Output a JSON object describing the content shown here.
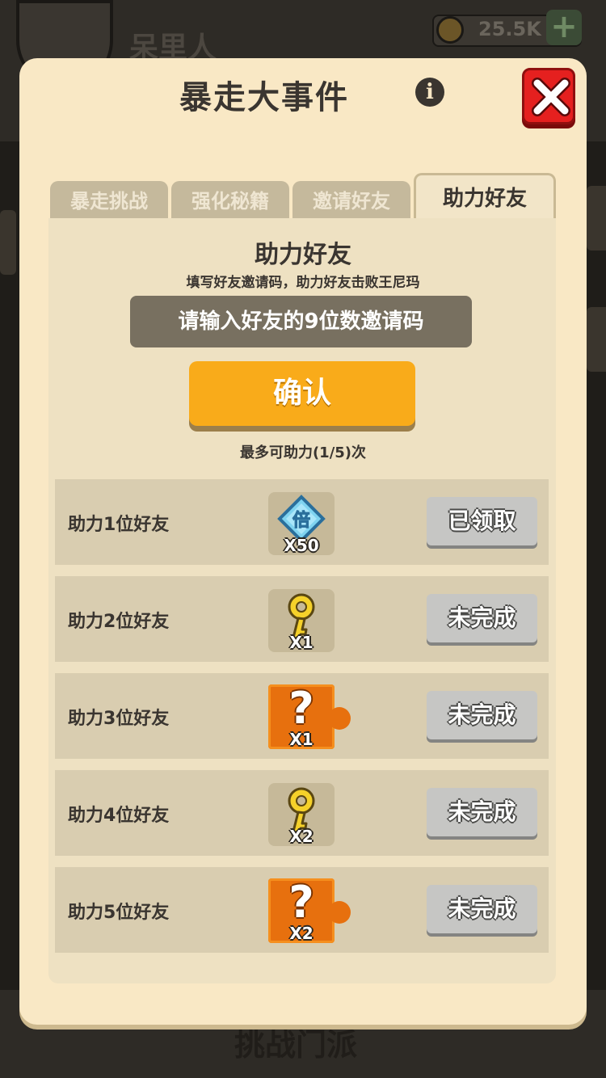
{
  "background": {
    "player_name": "呆里人",
    "coins": "25.5K",
    "bottom_label": "挑战门派"
  },
  "modal": {
    "title": "暴走大事件",
    "info_icon": "info-icon",
    "close_icon": "close-icon"
  },
  "tabs": [
    {
      "label": "暴走挑战",
      "active": false
    },
    {
      "label": "强化秘籍",
      "active": false
    },
    {
      "label": "邀请好友",
      "active": false
    },
    {
      "label": "助力好友",
      "active": true
    }
  ],
  "panel": {
    "title": "助力好友",
    "subtitle": "填写好友邀请码，助力好友击败王尼玛",
    "input_placeholder": "请输入好友的9位数邀请码",
    "input_value": "",
    "confirm_label": "确认",
    "limit_text": "最多可助力(1/5)次"
  },
  "rewards": [
    {
      "label": "助力1位好友",
      "item": "multiplier-gem-icon",
      "icon_text": "倍",
      "count": "X50",
      "status": "已领取"
    },
    {
      "label": "助力2位好友",
      "item": "gold-key-icon",
      "count": "X1",
      "status": "未完成"
    },
    {
      "label": "助力3位好友",
      "item": "mystery-puzzle-icon",
      "icon_text": "?",
      "count": "X1",
      "status": "未完成"
    },
    {
      "label": "助力4位好友",
      "item": "gold-key-icon",
      "count": "X2",
      "status": "未完成"
    },
    {
      "label": "助力5位好友",
      "item": "mystery-puzzle-icon",
      "icon_text": "?",
      "count": "X2",
      "status": "未完成"
    }
  ],
  "colors": {
    "modal_bg": "#f9e8c5",
    "confirm": "#f9ab1a",
    "close": "#e5201f",
    "puzzle": "#e7700e"
  }
}
